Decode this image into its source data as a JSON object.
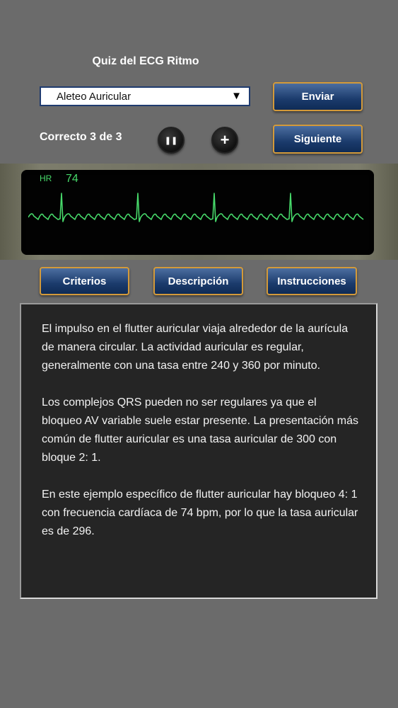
{
  "header": {
    "title": "Quiz del ECG Ritmo"
  },
  "answer_select": {
    "selected": "Aleteo Auricular"
  },
  "actions": {
    "submit_label": "Enviar",
    "next_label": "Siguiente"
  },
  "score": {
    "text": "Correcto 3 de 3"
  },
  "controls": {
    "pause_symbol": "❚❚",
    "plus_symbol": "+"
  },
  "monitor": {
    "hr_label": "HR",
    "hr_value": "74",
    "trace_color": "#47d96a"
  },
  "tabs": {
    "criteria": "Criterios",
    "description": "Descripción",
    "instructions": "Instrucciones"
  },
  "description": {
    "paragraphs": [
      "El impulso en el flutter auricular viaja alrededor de la aurícula de manera circular. La actividad auricular es regular, generalmente con una tasa entre 240 y 360 por minuto.",
      "Los complejos QRS pueden no ser regulares ya que el bloqueo AV variable suele estar presente. La presentación más común de flutter auricular es una tasa auricular de 300 con bloque 2: 1.",
      "En este ejemplo específico de flutter auricular hay bloqueo 4: 1 con frecuencia cardíaca de 74 bpm, por lo que la tasa auricular es de 296."
    ]
  },
  "colors": {
    "background": "#6b6b6b",
    "button_blue": "#1b3b6c",
    "button_border": "#d39a3a",
    "panel": "#252525"
  }
}
